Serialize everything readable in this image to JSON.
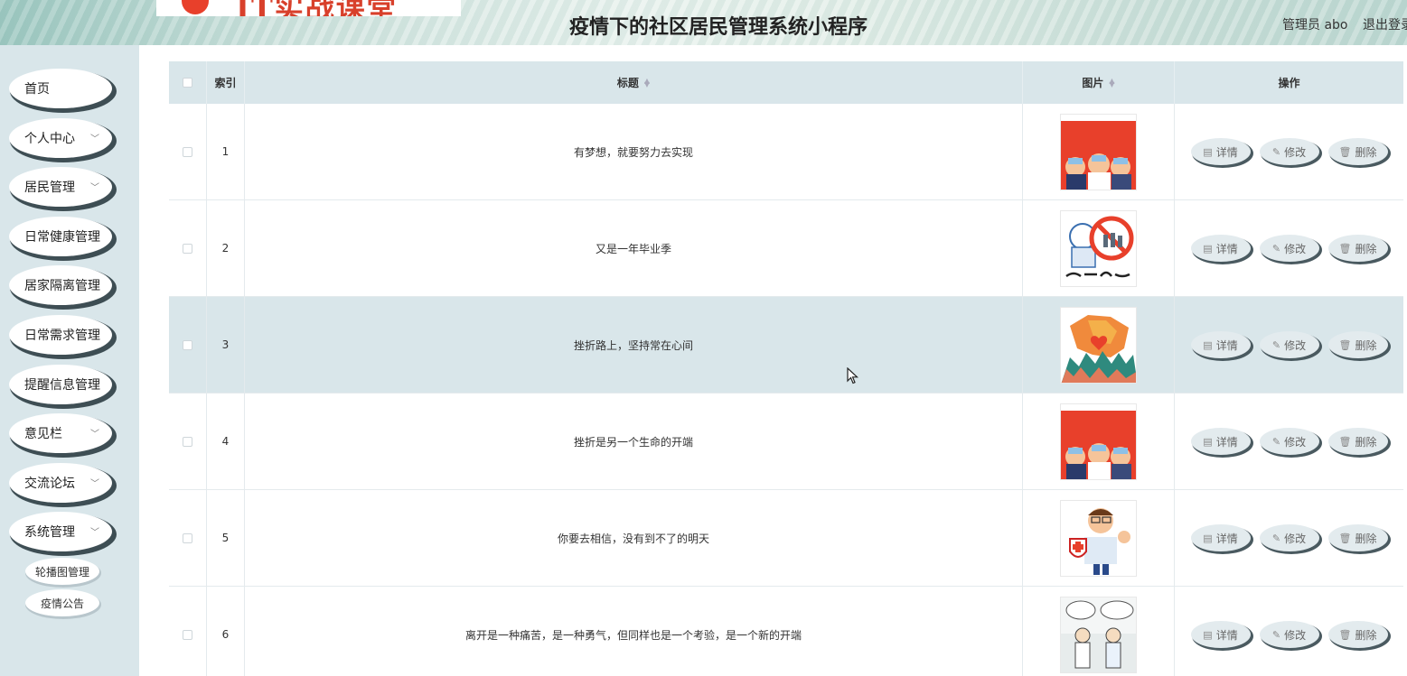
{
  "header": {
    "logo_text": "IT实战课堂",
    "title": "疫情下的社区居民管理系统小程序",
    "user": "管理员 abo",
    "logout": "退出登录"
  },
  "sidebar": {
    "items": [
      {
        "label": "首页",
        "chevron": false
      },
      {
        "label": "个人中心",
        "chevron": true
      },
      {
        "label": "居民管理",
        "chevron": true
      },
      {
        "label": "日常健康管理",
        "chevron": false
      },
      {
        "label": "居家隔离管理",
        "chevron": false
      },
      {
        "label": "日常需求管理",
        "chevron": false
      },
      {
        "label": "提醒信息管理",
        "chevron": false
      },
      {
        "label": "意见栏",
        "chevron": true
      },
      {
        "label": "交流论坛",
        "chevron": true
      },
      {
        "label": "系统管理",
        "chevron": true
      }
    ],
    "sub_items": [
      {
        "label": "轮播图管理"
      },
      {
        "label": "疫情公告"
      }
    ]
  },
  "table": {
    "headers": {
      "index": "索引",
      "title": "标题",
      "image": "图片",
      "actions": "操作"
    },
    "actions": {
      "detail": "详情",
      "edit": "修改",
      "delete": "删除"
    },
    "rows": [
      {
        "index": "1",
        "title": "有梦想，就要努力去实现",
        "image": "poster-red",
        "image_text": "科学防疫战疫 健康平安同行"
      },
      {
        "index": "2",
        "title": "又是一年毕业季",
        "image": "no-gathering",
        "image_text": "不聚人多处"
      },
      {
        "index": "3",
        "title": "挫折路上，坚持常在心间",
        "image": "map-heart",
        "image_text": ""
      },
      {
        "index": "4",
        "title": "挫折是另一个生命的开端",
        "image": "poster-red",
        "image_text": "科学防疫战疫 健康平安同行"
      },
      {
        "index": "5",
        "title": "你要去相信，没有到不了的明天",
        "image": "doctor",
        "image_text": ""
      },
      {
        "index": "6",
        "title": "离开是一种痛苦，是一种勇气，但同样也是一个考验，是一个新的开端",
        "image": "comic",
        "image_text": ""
      }
    ],
    "highlighted_row": 3
  },
  "colors": {
    "sidebar_bg": "#d9e6ea",
    "table_header_bg": "#d9e6ea",
    "button_shadow": "#3e4e54",
    "poster_red": "#e8402b"
  },
  "icons": {
    "detail": "document-icon",
    "edit": "pencil-icon",
    "delete": "trash-icon"
  }
}
